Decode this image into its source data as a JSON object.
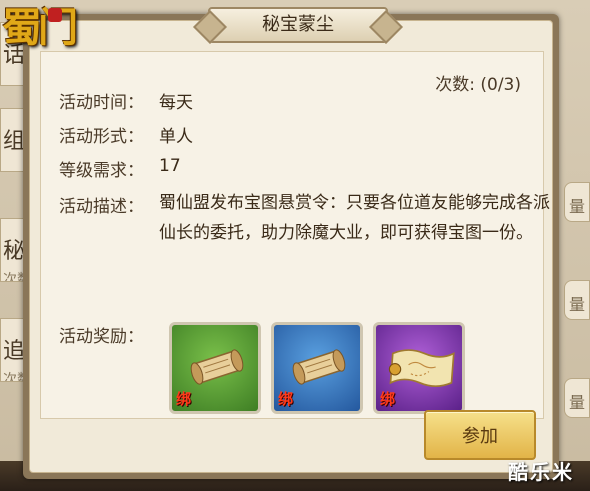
{
  "dialog": {
    "title": "秘宝蒙尘",
    "count_label": "次数: (0/3)",
    "fields": [
      {
        "label": "活动时间：",
        "value": "每天"
      },
      {
        "label": "活动形式：",
        "value": "单人"
      },
      {
        "label": "等级需求：",
        "value": "17"
      }
    ],
    "description_label": "活动描述：",
    "description": "蜀仙盟发布宝图悬赏令：只要各位道友能够完成各派仙长的委托，助力除魔大业，即可获得宝图一份。",
    "rewards_label": "活动奖励：",
    "rewards": [
      {
        "icon": "scroll-icon",
        "tag": "绑",
        "rarity": "green"
      },
      {
        "icon": "scroll-icon",
        "tag": "绑",
        "rarity": "blue"
      },
      {
        "icon": "treasure-map-icon",
        "tag": "绑",
        "rarity": "purple"
      }
    ],
    "join_label": "参加"
  },
  "background": {
    "left_tabs": [
      {
        "label": "话",
        "sub": ""
      },
      {
        "label": "组",
        "sub": ""
      },
      {
        "label": "秘",
        "sub": "次数"
      },
      {
        "label": "追",
        "sub": "次数"
      }
    ],
    "right_tabs": [
      "量",
      "量",
      "量"
    ]
  },
  "logo": "蜀门",
  "watermark": "酷乐米"
}
